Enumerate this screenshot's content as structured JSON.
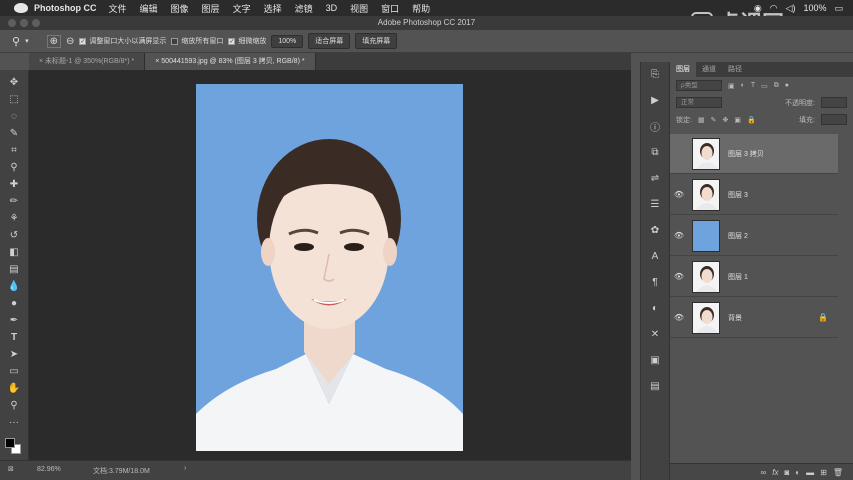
{
  "menubar": {
    "app_name": "Photoshop CC",
    "items": [
      "文件",
      "编辑",
      "图像",
      "图层",
      "文字",
      "选择",
      "滤镜",
      "3D",
      "视图",
      "窗口",
      "帮助"
    ],
    "battery": "100%"
  },
  "window": {
    "title": "Adobe Photoshop CC 2017"
  },
  "options_bar": {
    "resize_windows_label": "调整窗口大小以满屏显示",
    "zoom_all_label": "缩放所有窗口",
    "scrubby_zoom_label": "细微缩放",
    "zoom_value": "100%",
    "fit_screen_label": "适合屏幕",
    "fill_screen_label": "填充屏幕"
  },
  "doc_tabs": [
    {
      "label": "未标题-1 @ 350%(RGB/8*) *"
    },
    {
      "label": "500441593.jpg @ 83% (图层 3 拷贝, RGB/8) *"
    }
  ],
  "status_bar": {
    "zoom": "82.96%",
    "doc_info": "文档:3.79M/18.0M"
  },
  "layers_panel": {
    "tabs": [
      "图层",
      "通道",
      "路径"
    ],
    "filter_label": "ρ类型",
    "blend_mode": "正常",
    "opacity_label": "不透明度:",
    "lock_label": "锁定:",
    "fill_label": "填充:",
    "layers": [
      {
        "name": "图层 3 拷贝",
        "type": "portrait"
      },
      {
        "name": "图层 3",
        "type": "portrait"
      },
      {
        "name": "图层 2",
        "type": "blue"
      },
      {
        "name": "图层 1",
        "type": "portrait"
      },
      {
        "name": "背景",
        "type": "portrait",
        "locked": true
      }
    ]
  },
  "watermark": {
    "text": "虎课网"
  },
  "colors": {
    "photo_bg": "#6fa3de",
    "selected_layer": "#6a6a6a"
  }
}
